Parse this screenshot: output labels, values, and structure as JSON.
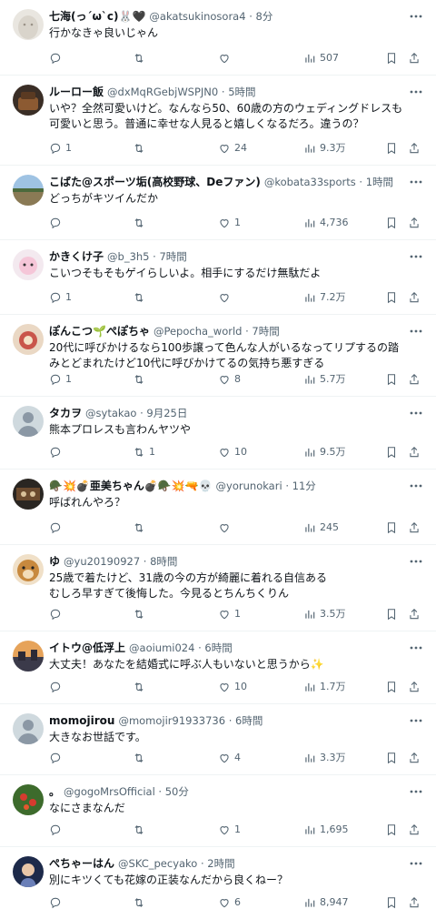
{
  "tweets": [
    {
      "name": "七海(っ´ω`c)🐰🖤",
      "meta": "@akatsukinosora4 · 8分",
      "text": "行かなきゃ良いじゃん",
      "reply": "",
      "retweet": "",
      "like": "",
      "views": "507"
    },
    {
      "name": "ルーロー飯",
      "meta": "@dxMqRGebjWSPJN0 · 5時間",
      "text": "いや？全然可愛いけど。なんなら50、60歳の方のウェディングドレスも可愛いと思う。普通に幸せな人見ると嬉しくなるだろ。違うの？",
      "reply": "1",
      "retweet": "",
      "like": "24",
      "views": "9.3万"
    },
    {
      "name": "こばた@スポーツ垢(高校野球、Deファン)",
      "meta": "@kobata33sports · 1時間",
      "text": "どっちがキツイんだか",
      "reply": "",
      "retweet": "",
      "like": "1",
      "views": "4,736"
    },
    {
      "name": "かきくけ子",
      "meta": "@b_3h5 · 7時間",
      "text": "こいつそもそもゲイらしいよ。相手にするだけ無駄だよ",
      "reply": "1",
      "retweet": "",
      "like": "",
      "views": "7.2万"
    },
    {
      "name": "ぽんこつ🌱ぺぽちゃ",
      "meta": "@Pepocha_world · 7時間",
      "text": "20代に呼びかけるなら100歩譲って色んな人がいるなってリプするの踏みとどまれたけど10代に呼びかけてるの気持ち悪すぎる",
      "reply": "1",
      "retweet": "",
      "like": "8",
      "views": "5.7万"
    },
    {
      "name": "タカヲ",
      "meta": "@sytakao · 9月25日",
      "text": "熊本プロレスも言わんヤツや",
      "reply": "",
      "retweet": "1",
      "like": "10",
      "views": "9.5万"
    },
    {
      "name": "🪖💥💣亜美ちゃん💣🪖💥🔫💀",
      "meta": "@yorunokari · 11分",
      "text": "呼ばれんやろ？",
      "reply": "",
      "retweet": "",
      "like": "",
      "views": "245"
    },
    {
      "name": "ゆ",
      "meta": "@yu20190927 · 8時間",
      "text": "25歳で着たけど、31歳の今の方が綺麗に着れる自信ある\nむしろ早すぎて後悔した。今見るとちんちくりん",
      "reply": "",
      "retweet": "",
      "like": "1",
      "views": "3.5万"
    },
    {
      "name": "イトウ@低浮上",
      "meta": "@aoiumi024 · 6時間",
      "text": "大丈夫！あなたを結婚式に呼ぶ人もいないと思うから✨",
      "reply": "",
      "retweet": "",
      "like": "10",
      "views": "1.7万"
    },
    {
      "name": "momojirou",
      "meta": "@momojir91933736 · 6時間",
      "text": "大きなお世話です。",
      "reply": "",
      "retweet": "",
      "like": "4",
      "views": "3.3万"
    },
    {
      "name": "。",
      "meta": "@gogoMrsOfficial · 50分",
      "text": "なにさまなんだ",
      "reply": "",
      "retweet": "",
      "like": "1",
      "views": "1,695"
    },
    {
      "name": "ぺちゃーはん",
      "meta": "@SKC_pecyako · 2時間",
      "text": "別にキツくても花嫁の正装なんだから良くねー？",
      "reply": "",
      "retweet": "",
      "like": "6",
      "views": "8,947"
    }
  ],
  "icons": {
    "reply": "reply-icon",
    "retweet": "retweet-icon",
    "like": "heart-icon",
    "views": "views-icon",
    "bookmark": "bookmark-icon",
    "share": "share-icon",
    "more": "more-icon"
  },
  "colors": {
    "text": "#0f1419",
    "secondary": "#536471",
    "divider": "#eff3f4"
  }
}
